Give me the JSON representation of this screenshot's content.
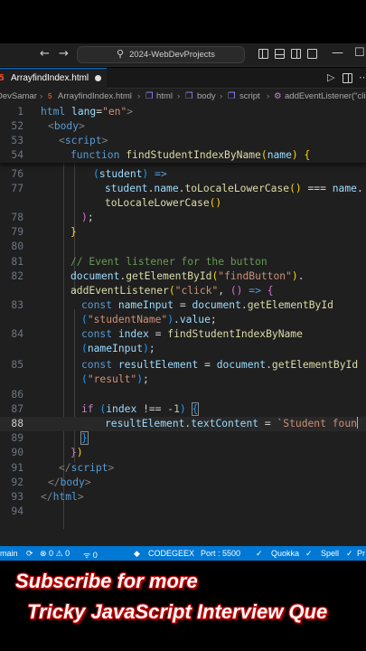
{
  "titlebar": {
    "search_icon": "⚲",
    "command_center_text": "2024-WebDevProjects",
    "back_arrow": "←",
    "forward_arrow": "→",
    "minimize": "—",
    "maximize": "☐"
  },
  "tab": {
    "icon_text": "5",
    "filename": "ArrayfindIndex.html",
    "run_icon": "▷",
    "more_icon": "⋯"
  },
  "breadcrumb": {
    "folder": "DevSamar",
    "file": "ArrayfindIndex.html",
    "html": "html",
    "body": "body",
    "script": "script",
    "fn": "addEventListener(\"click"
  },
  "lines": {
    "l1": {
      "num": "1",
      "tag_open": "html",
      "attr": "lang",
      "val": "\"en\"",
      "close": ">"
    },
    "l52": {
      "num": "52",
      "tag": "body"
    },
    "l53": {
      "num": "53",
      "tag": "script"
    },
    "l54": {
      "num": "54",
      "kw": "function",
      "fn": "findStudentIndexByName",
      "param": "name",
      "brace": "{"
    },
    "l76": {
      "num": "76",
      "param": "student",
      "arrow": "=>"
    },
    "l77": {
      "num": "77",
      "obj": "student",
      "prop": "name",
      "method": "toLocaleLowerCase",
      "op": "===",
      "name": "name"
    },
    "l77b": {
      "method": "toLocaleLowerCase"
    },
    "l78": {
      "num": "78",
      "text": ");"
    },
    "l79": {
      "num": "79",
      "text": "}"
    },
    "l80": {
      "num": "80"
    },
    "l81": {
      "num": "81",
      "comment": "// Event listener for the button"
    },
    "l82": {
      "num": "82",
      "obj": "document",
      "method": "getElementById",
      "arg": "\"findButton\""
    },
    "l82b": {
      "method": "addEventListener",
      "arg": "\"click\"",
      "arrow": "=>"
    },
    "l83": {
      "num": "83",
      "kw": "const",
      "var": "nameInput",
      "obj": "document",
      "method": "getElementById"
    },
    "l83b": {
      "arg": "\"studentName\"",
      "prop": "value"
    },
    "l84": {
      "num": "84",
      "kw": "const",
      "var": "index",
      "fn": "findStudentIndexByName"
    },
    "l84b": {
      "arg": "nameInput"
    },
    "l85": {
      "num": "85",
      "kw": "const",
      "var": "resultElement",
      "obj": "document",
      "method": "getElementById"
    },
    "l85b": {
      "arg": "\"result\""
    },
    "l86": {
      "num": "86"
    },
    "l87": {
      "num": "87",
      "kw": "if",
      "var": "index",
      "op": "!==",
      "n": "-1"
    },
    "l88": {
      "num": "88",
      "obj": "resultElement",
      "prop": "textContent",
      "str": "`Student foun"
    },
    "l89": {
      "num": "89"
    },
    "l90": {
      "num": "90"
    },
    "l91": {
      "num": "91",
      "tag": "script"
    },
    "l92": {
      "num": "92",
      "tag": "body"
    },
    "l93": {
      "num": "93",
      "tag": "html"
    },
    "l94": {
      "num": "94"
    }
  },
  "statusbar": {
    "branch": "main",
    "errors": "⊗ 0 ⚠ 0",
    "ports": "ᯤ 0",
    "codegeex": "CODEGEEX",
    "port": "Port : 5500",
    "quokka": "Quokka",
    "spell": "Spell",
    "prettier": "Pr"
  },
  "caption": {
    "line1": "Subscribe for more",
    "line2": "Tricky JavaScript Interview Que"
  },
  "colors": {
    "accent": "#0078d4",
    "caption_glow": "#c00000"
  }
}
